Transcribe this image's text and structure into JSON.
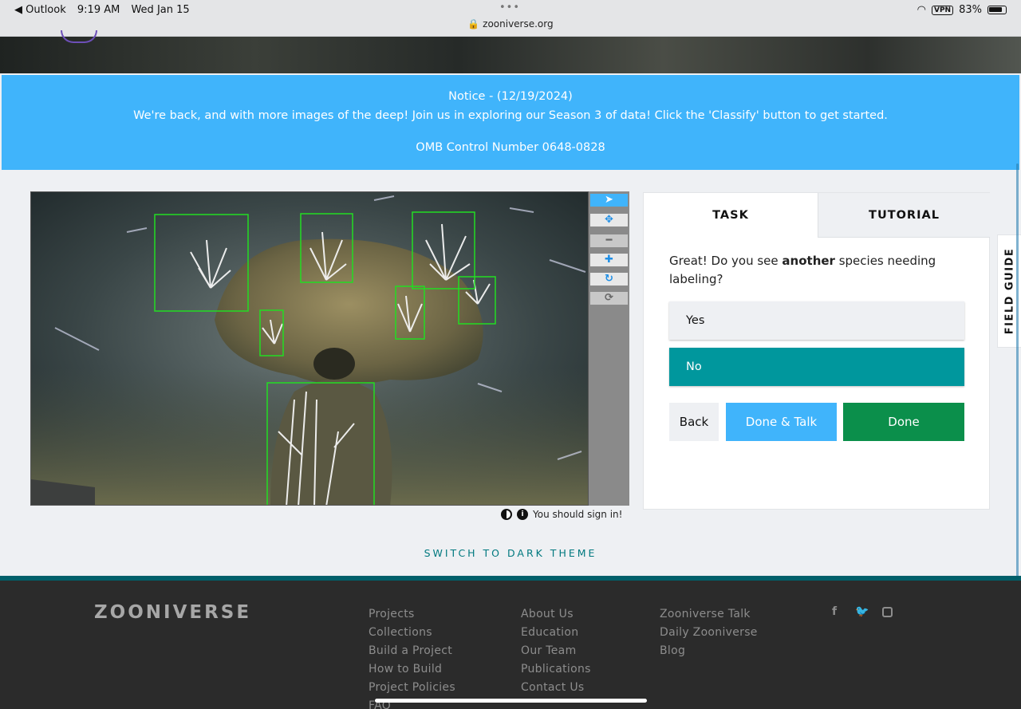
{
  "status_bar": {
    "back_app": "◀ Outlook",
    "time": "9:19 AM",
    "date": "Wed Jan 15",
    "url": "zooniverse.org",
    "vpn": "VPN",
    "battery": "83%"
  },
  "notice": {
    "title": "Notice - (12/19/2024)",
    "message": "We're back, and with more images of the deep! Join us in exploring our Season 3 of data! Click the 'Classify' button to get started.",
    "omb": "OMB Control Number 0648-0828"
  },
  "viewer": {
    "tools": [
      "pointer",
      "move",
      "zoom-out",
      "zoom-in",
      "rotate",
      "reset"
    ],
    "signin_text": "You should sign in!"
  },
  "task_panel": {
    "tabs": {
      "task": "TASK",
      "tutorial": "TUTORIAL"
    },
    "question_pre": "Great! Do you see ",
    "question_bold": "another",
    "question_post": " species needing labeling?",
    "answers": {
      "yes": "Yes",
      "no": "No"
    },
    "buttons": {
      "back": "Back",
      "done_talk": "Done & Talk",
      "done": "Done"
    }
  },
  "field_guide": "FIELD GUIDE",
  "switch_theme": "SWITCH TO DARK THEME",
  "footer": {
    "logo": "ZOONIVERSE",
    "col1": [
      "Projects",
      "Collections",
      "Build a Project",
      "How to Build",
      "Project Policies",
      "FAQ"
    ],
    "col2": [
      "About Us",
      "Education",
      "Our Team",
      "Publications",
      "Contact Us"
    ],
    "col3": [
      "Zooniverse Talk",
      "Daily Zooniverse",
      "Blog"
    ]
  },
  "colors": {
    "notice_bg": "#40b4fb",
    "selected_answer": "#00979d",
    "done_button": "#0b8f4b",
    "annotation_box": "#22dd22",
    "footer_bg": "#2b2b2b"
  }
}
